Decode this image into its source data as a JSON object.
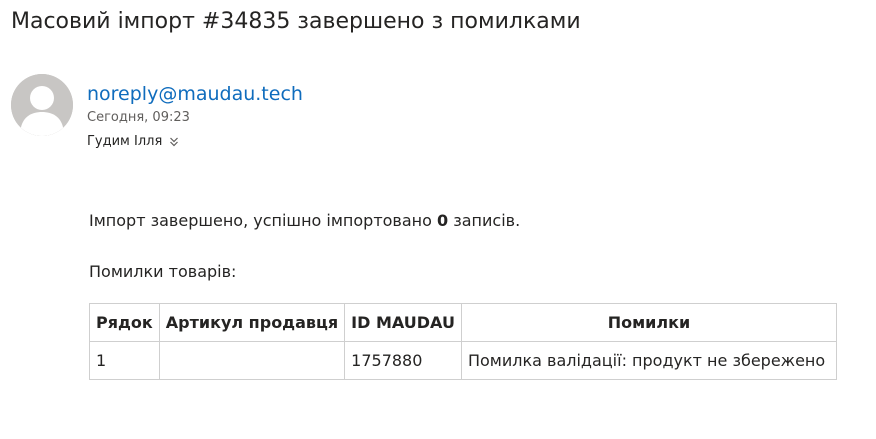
{
  "subject": "Масовий імпорт #34835 завершено з помилками",
  "sender": {
    "email": "noreply@maudau.tech",
    "time": "Сегодня, 09:23",
    "recipient": "Гудим Ілля"
  },
  "message": {
    "line1_prefix": "Імпорт завершено, успішно імпортовано ",
    "line1_count": "0",
    "line1_suffix": " записів.",
    "line2": "Помилки товарів:"
  },
  "table": {
    "headers": [
      "Рядок",
      "Артикул продавця",
      "ID MAUDAU",
      "Помилки"
    ],
    "rows": [
      [
        "1",
        "",
        "1757880",
        "Помилка валідації: продукт не збережено"
      ]
    ]
  },
  "icons": {
    "avatar": "person-avatar-icon",
    "expand": "chevron-double-down-icon"
  },
  "colors": {
    "link": "#0f6cbd",
    "avatar_bg": "#c8c6c4",
    "border": "#cfcfcf"
  }
}
